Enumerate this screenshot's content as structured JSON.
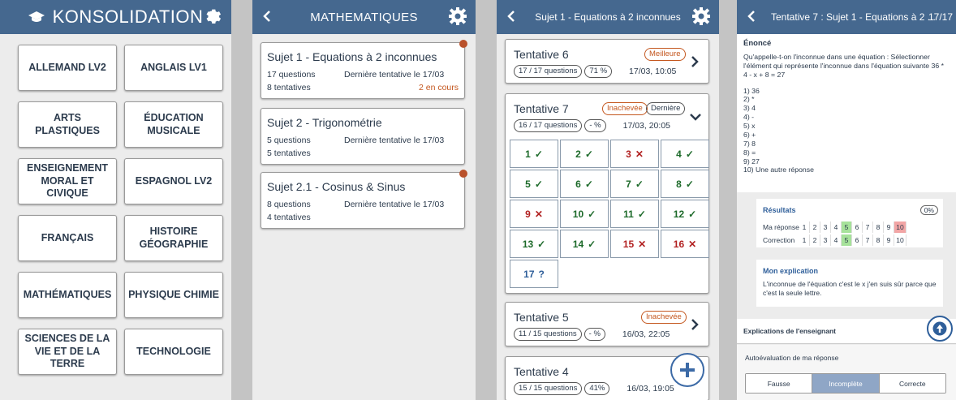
{
  "screen1": {
    "title": "KONSOLIDATION",
    "subjects": [
      "ALLEMAND LV2",
      "ANGLAIS LV1",
      "ARTS PLASTIQUES",
      "ÉDUCATION MUSICALE",
      "ENSEIGNEMENT MORAL ET CIVIQUE",
      "ESPAGNOL LV2",
      "FRANÇAIS",
      "HISTOIRE GÉOGRAPHIE",
      "MATHÉMATIQUES",
      "PHYSIQUE CHIMIE",
      "SCIENCES DE LA VIE ET DE LA TERRE",
      "TECHNOLOGIE"
    ]
  },
  "screen2": {
    "title": "MATHEMATIQUES",
    "cards": [
      {
        "title": "Sujet 1 - Equations à 2 inconnues",
        "questions": "17 questions",
        "last": "Dernière tentative le 17/03",
        "attempts": "8 tentatives",
        "status": "2 en cours"
      },
      {
        "title": "Sujet 2 - Trigonométrie",
        "questions": "5 questions",
        "last": "Dernière tentative le 17/03",
        "attempts": "5 tentatives",
        "status": ""
      },
      {
        "title": "Sujet 2.1 - Cosinus & Sinus",
        "questions": "8 questions",
        "last": "Dernière tentative le 17/03",
        "attempts": "4 tentatives",
        "status": ""
      }
    ]
  },
  "screen3": {
    "title": "Sujet 1 - Equations à 2 inconnues",
    "t6": {
      "title": "Tentative 6",
      "badge": "Meilleure",
      "q": "17 / 17 questions",
      "pct": "71 %",
      "date": "17/03, 10:05"
    },
    "t7": {
      "title": "Tentative 7",
      "badge1": "Inachevée",
      "badge2": "Dernière",
      "q": "16 / 17 questions",
      "pct": "- %",
      "date": "17/03, 20:05"
    },
    "grid": [
      {
        "n": "1",
        "s": "✓"
      },
      {
        "n": "2",
        "s": "✓"
      },
      {
        "n": "3",
        "s": "✕"
      },
      {
        "n": "4",
        "s": "✓"
      },
      {
        "n": "5",
        "s": "✓"
      },
      {
        "n": "6",
        "s": "✓"
      },
      {
        "n": "7",
        "s": "✓"
      },
      {
        "n": "8",
        "s": "✓"
      },
      {
        "n": "9",
        "s": "✕"
      },
      {
        "n": "10",
        "s": "✓"
      },
      {
        "n": "11",
        "s": "✓"
      },
      {
        "n": "12",
        "s": "✓"
      },
      {
        "n": "13",
        "s": "✓"
      },
      {
        "n": "14",
        "s": "✓"
      },
      {
        "n": "15",
        "s": "✕"
      },
      {
        "n": "16",
        "s": "✕"
      },
      {
        "n": "17",
        "s": "?"
      }
    ],
    "t5": {
      "title": "Tentative 5",
      "badge": "Inachevée",
      "q": "11 / 15 questions",
      "pct": "- %",
      "date": "16/03, 22:05"
    },
    "t4": {
      "title": "Tentative 4",
      "q": "15 / 15 questions",
      "pct": "41%",
      "date": "16/03, 19:05"
    }
  },
  "screen4": {
    "title": "Tentative 7 : Sujet 1 - Equations à 2 ...",
    "counter": "17/17",
    "enonce_label": "Énoncé",
    "question": "Qu'appelle-t-on l'inconnue dans une équation : Sélectionner l'élément qui représente l'inconnue dans l'équation suivante 36 * 4 - x + 8 = 27",
    "options": [
      "1) 36",
      "2) *",
      "3) 4",
      "4) -",
      "5) x",
      "6) +",
      "7) 8",
      "8) =",
      "9) 27",
      "10) Une autre réponse"
    ],
    "results_label": "Résultats",
    "results_pct": "0%",
    "my_answer_label": "Ma réponse",
    "correction_label": "Correction",
    "nums": [
      "1",
      "2",
      "3",
      "4",
      "5",
      "6",
      "7",
      "8",
      "9",
      "10"
    ],
    "explanation_label": "Mon explication",
    "explanation": "L'inconnue de l'équation c'est le x j'en suis sûr parce que c'est la seule lettre.",
    "teacher_label": "Explications de l'enseignant",
    "autoeval_label": "Autoévaluation de ma réponse",
    "choices": [
      "Fausse",
      "Incomplète",
      "Correcte"
    ]
  }
}
